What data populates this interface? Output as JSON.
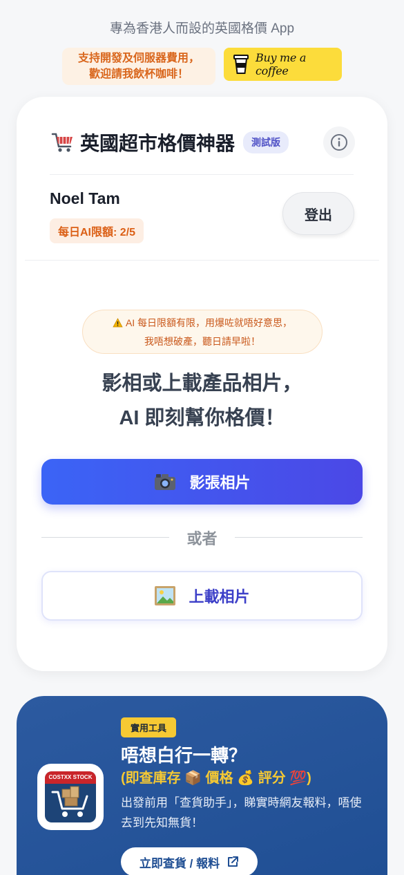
{
  "header": {
    "tagline": "專為香港人而設的英國格價 App",
    "support_line1": "支持開發及伺服器費用，",
    "support_line2": "歡迎請我飲杯咖啡！",
    "coffee_label": "Buy me a coffee"
  },
  "app": {
    "title": "英國超市格價神器",
    "beta_badge": "測試版"
  },
  "user": {
    "name": "Noel Tam",
    "quota": "每日AI限額: 2/5",
    "logout_label": "登出"
  },
  "main": {
    "warning_line1": "AI 每日限額有限，用爆咗就唔好意思，",
    "warning_line2": "我唔想破產，聽日請早啦！",
    "headline_line1": "影相或上載產品相片，",
    "headline_line2": "AI 即刻幫你格價！",
    "take_photo_label": "影張相片",
    "or_label": "或者",
    "upload_label": "上載相片"
  },
  "promo": {
    "badge": "實用工具",
    "title": "唔想白行一轉？",
    "subtitle": "(即查庫存 📦 價格 💰 評分 💯)",
    "desc": "出發前用「查貨助手」，睇實時網友報料，唔使去到先知無貨！",
    "button_label": "立即查貨 / 報料",
    "app_icon_text": "COSTXX STOCK"
  },
  "colors": {
    "accent": "#3b64f6",
    "brand_coffee": "#fcdc3b",
    "promo_bg": "#2c5aa0"
  }
}
